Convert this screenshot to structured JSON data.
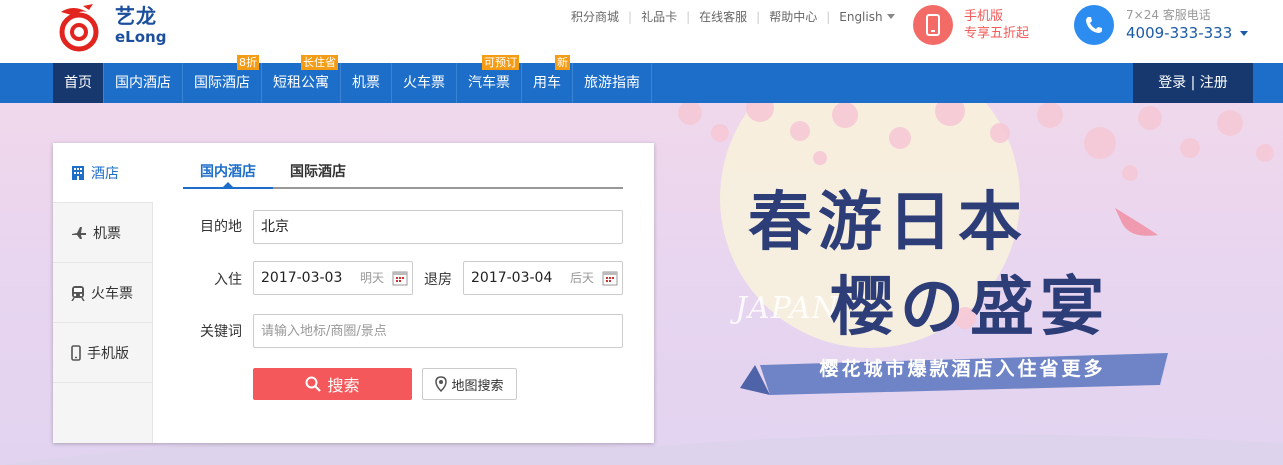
{
  "header": {
    "logo": {
      "name": "艺龙",
      "sub": "eLong"
    },
    "links": [
      "积分商城",
      "礼品卡",
      "在线客服",
      "帮助中心"
    ],
    "language": "English",
    "mobile_promo": {
      "line1": "手机版",
      "line2": "专享五折起"
    },
    "hotline": {
      "label": "7×24 客服电话",
      "number": "4009-333-333"
    }
  },
  "nav": {
    "items": [
      {
        "label": "首页",
        "badge": ""
      },
      {
        "label": "国内酒店",
        "badge": ""
      },
      {
        "label": "国际酒店",
        "badge": "8折"
      },
      {
        "label": "短租公寓",
        "badge": "长住省"
      },
      {
        "label": "机票",
        "badge": ""
      },
      {
        "label": "火车票",
        "badge": ""
      },
      {
        "label": "汽车票",
        "badge": "可预订"
      },
      {
        "label": "用车",
        "badge": "新"
      },
      {
        "label": "旅游指南",
        "badge": ""
      }
    ],
    "login": "登录 | 注册"
  },
  "search_panel": {
    "categories": [
      "酒店",
      "机票",
      "火车票",
      "手机版"
    ],
    "tabs": [
      "国内酒店",
      "国际酒店"
    ],
    "destination": {
      "label": "目的地",
      "value": "北京"
    },
    "checkin": {
      "label": "入住",
      "value": "2017-03-03",
      "hint": "明天"
    },
    "checkout": {
      "label": "退房",
      "value": "2017-03-04",
      "hint": "后天"
    },
    "keyword": {
      "label": "关键词",
      "placeholder": "请输入地标/商圈/景点"
    },
    "search_button": "搜索",
    "map_button": "地图搜索"
  },
  "banner": {
    "line1": "春游日本",
    "line2": "樱の盛宴",
    "watermark": "JAPAN",
    "ribbon": "樱花城市爆款酒店入住省更多"
  },
  "colors": {
    "nav": "#1d6ec9",
    "nav_dark": "#16386e",
    "accent_red": "#f4585a",
    "badge": "#f49c16",
    "banner_text": "#2d3d78"
  }
}
